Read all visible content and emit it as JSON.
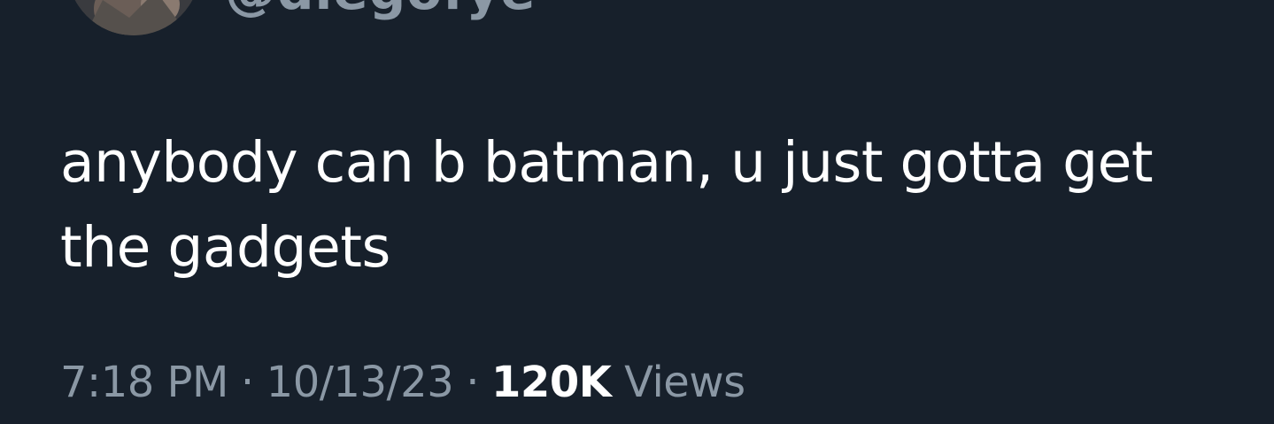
{
  "author": {
    "handle": "@diegofye"
  },
  "tweet": {
    "text_line_1": "anybody can b batman, u just gotta get",
    "text_line_2": "the gadgets"
  },
  "meta": {
    "time": "7:18 PM",
    "separator": "·",
    "date": "10/13/23",
    "views_count": "120K",
    "views_label": "Views"
  },
  "colors": {
    "background": "#17202b",
    "text": "#ffffff",
    "secondary": "#8b98a5"
  }
}
